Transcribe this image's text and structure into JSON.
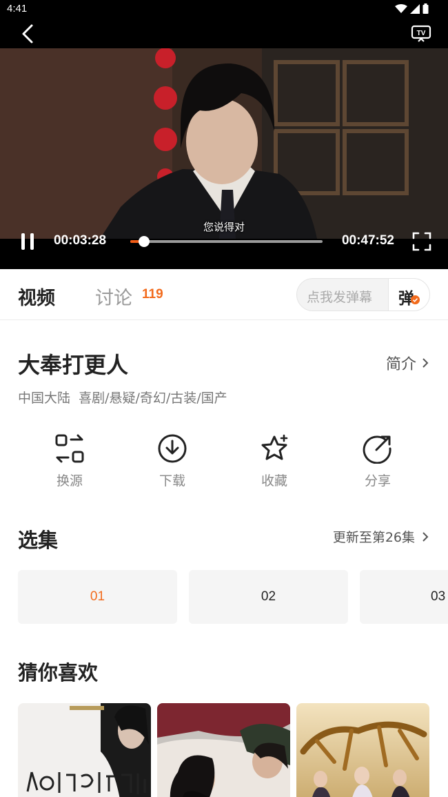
{
  "status_bar": {
    "time": "4:41"
  },
  "player": {
    "subtitle": "您说得对",
    "current_time": "00:03:28",
    "total_time": "00:47:52",
    "progress_percent": 7.2
  },
  "tabs": {
    "video_label": "视频",
    "discuss_label": "讨论",
    "discuss_count": "119"
  },
  "danmu": {
    "placeholder": "点我发弹幕",
    "button_label": "弹"
  },
  "show": {
    "title": "大奉打更人",
    "intro_link": "简介",
    "meta": "中国大陆  喜剧/悬疑/奇幻/古装/国产"
  },
  "actions": [
    {
      "label": "换源",
      "icon": "switch-source-icon"
    },
    {
      "label": "下载",
      "icon": "download-icon"
    },
    {
      "label": "收藏",
      "icon": "star-icon"
    },
    {
      "label": "分享",
      "icon": "share-icon"
    }
  ],
  "episodes": {
    "title": "选集",
    "update_text": "更新至第26集",
    "items": [
      "01",
      "02",
      "03"
    ],
    "selected_index": 0
  },
  "recommend": {
    "title": "猜你喜欢"
  },
  "colors": {
    "accent": "#f26a1b",
    "progress": "#f25c16"
  }
}
